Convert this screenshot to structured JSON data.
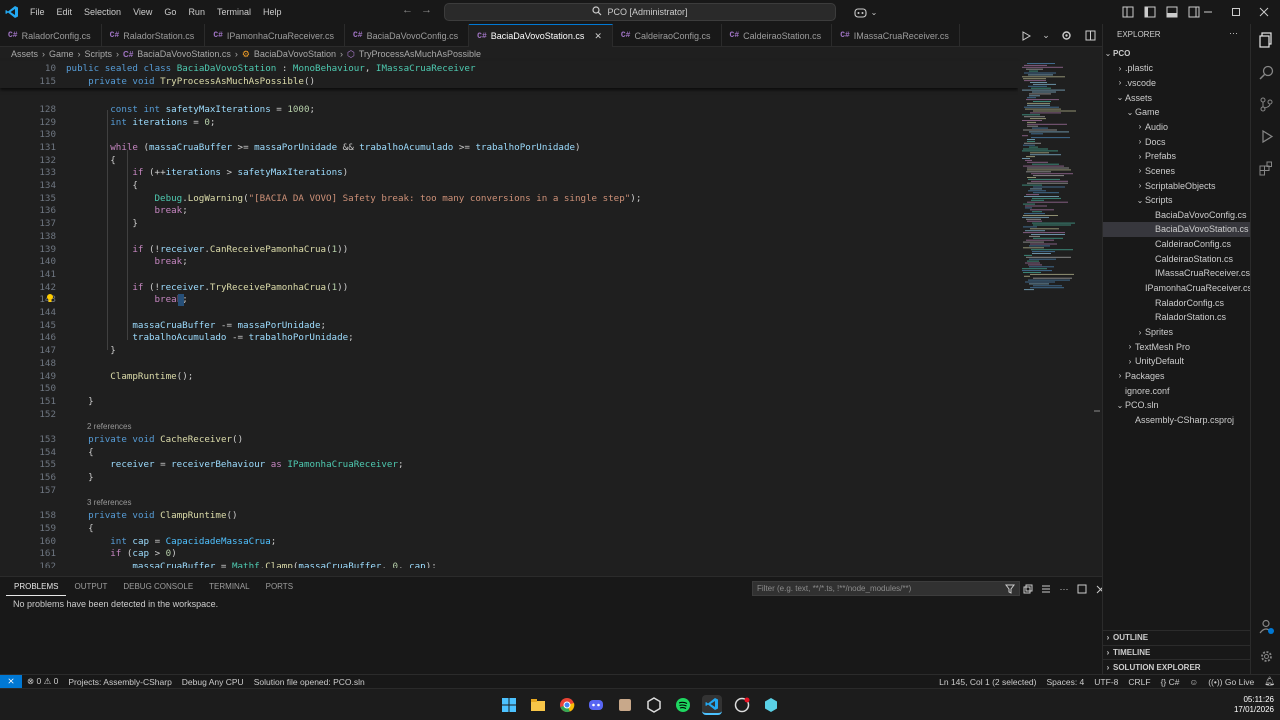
{
  "menu": [
    "File",
    "Edit",
    "Selection",
    "View",
    "Go",
    "Run",
    "Terminal",
    "Help"
  ],
  "command_center": "PCO [Administrator]",
  "tabs": [
    {
      "label": "RaladorConfig.cs",
      "active": false
    },
    {
      "label": "RaladorStation.cs",
      "active": false
    },
    {
      "label": "IPamonhaCruaReceiver.cs",
      "active": false
    },
    {
      "label": "BaciaDaVovoConfig.cs",
      "active": false
    },
    {
      "label": "BaciaDaVovoStation.cs",
      "active": true
    },
    {
      "label": "CaldeiraoConfig.cs",
      "active": false
    },
    {
      "label": "CaldeiraoStation.cs",
      "active": false
    },
    {
      "label": "IMassaCruaReceiver.cs",
      "active": false
    }
  ],
  "tab_icon_text": "C#",
  "breadcrumb": {
    "p1": "Assets",
    "p2": "Game",
    "p3": "Scripts",
    "p4": "BaciaDaVovoStation.cs",
    "p5": "BaciaDaVovoStation",
    "p6": "TryProcessAsMuchAsPossible"
  },
  "sticky": [
    {
      "num": "10",
      "code": "public sealed class BaciaDaVovoStation : MonoBehaviour, IMassaCruaReceiver"
    },
    {
      "num": "115",
      "code": "    private void TryProcessAsMuchAsPossible()"
    }
  ],
  "lines": [
    {
      "num": "128",
      "code": "        const int safetyMaxIterations = 1000;"
    },
    {
      "num": "129",
      "code": "        int iterations = 0;"
    },
    {
      "num": "130",
      "code": ""
    },
    {
      "num": "131",
      "code": "        while (massaCruaBuffer >= massaPorUnidade && trabalhoAcumulado >= trabalhoPorUnidade)"
    },
    {
      "num": "132",
      "code": "        {"
    },
    {
      "num": "133",
      "code": "            if (++iterations > safetyMaxIterations)"
    },
    {
      "num": "134",
      "code": "            {"
    },
    {
      "num": "135",
      "code": "                Debug.LogWarning(\"[BACIA DA VOVO] Safety break: too many conversions in a single step\");"
    },
    {
      "num": "136",
      "code": "                break;"
    },
    {
      "num": "137",
      "code": "            }"
    },
    {
      "num": "138",
      "code": ""
    },
    {
      "num": "139",
      "code": "            if (!receiver.CanReceivePamonhaCrua(1))"
    },
    {
      "num": "140",
      "code": "                break;"
    },
    {
      "num": "141",
      "code": ""
    },
    {
      "num": "142",
      "code": "            if (!receiver.TryReceivePamonhaCrua(1))"
    },
    {
      "num": "143",
      "code": "                break;"
    },
    {
      "num": "144",
      "code": ""
    },
    {
      "num": "145",
      "code": "            massaCruaBuffer -= massaPorUnidade;"
    },
    {
      "num": "146",
      "code": "            trabalhoAcumulado -= trabalhoPorUnidade;"
    },
    {
      "num": "147",
      "code": "        }"
    },
    {
      "num": "148",
      "code": ""
    },
    {
      "num": "149",
      "code": "        ClampRuntime();"
    },
    {
      "num": "150",
      "code": ""
    },
    {
      "num": "151",
      "code": "    }"
    },
    {
      "num": "152",
      "code": ""
    }
  ],
  "codelens_1": "2 references",
  "lines_b": [
    {
      "num": "153",
      "code": "    private void CacheReceiver()"
    },
    {
      "num": "154",
      "code": "    {"
    },
    {
      "num": "155",
      "code": "        receiver = receiverBehaviour as IPamonhaCruaReceiver;"
    },
    {
      "num": "156",
      "code": "    }"
    },
    {
      "num": "157",
      "code": ""
    }
  ],
  "codelens_2": "3 references",
  "lines_c": [
    {
      "num": "158",
      "code": "    private void ClampRuntime()"
    },
    {
      "num": "159",
      "code": "    {"
    },
    {
      "num": "160",
      "code": "        int cap = CapacidadeMassaCrua;"
    },
    {
      "num": "161",
      "code": "        if (cap > 0)"
    },
    {
      "num": "162",
      "code": "            massaCruaBuffer = Mathf.Clamp(massaCruaBuffer, 0, cap);"
    }
  ],
  "panel": {
    "tabs": [
      "Problems",
      "Output",
      "Debug Console",
      "Terminal",
      "Ports"
    ],
    "filter_placeholder": "Filter (e.g. text, **/*.ts, !**/node_modules/**)",
    "message": "No problems have been detected in the workspace."
  },
  "explorer": {
    "title": "EXPLORER",
    "root": "PCO",
    "items": [
      {
        "label": ".plastic",
        "depth": 1,
        "chev": "›",
        "sel": false
      },
      {
        "label": ".vscode",
        "depth": 1,
        "chev": "›",
        "sel": false
      },
      {
        "label": "Assets",
        "depth": 1,
        "chev": "⌄",
        "sel": false
      },
      {
        "label": "Game",
        "depth": 2,
        "chev": "⌄",
        "sel": false
      },
      {
        "label": "Audio",
        "depth": 3,
        "chev": "›",
        "sel": false
      },
      {
        "label": "Docs",
        "depth": 3,
        "chev": "›",
        "sel": false
      },
      {
        "label": "Prefabs",
        "depth": 3,
        "chev": "›",
        "sel": false
      },
      {
        "label": "Scenes",
        "depth": 3,
        "chev": "›",
        "sel": false
      },
      {
        "label": "ScriptableObjects",
        "depth": 3,
        "chev": "›",
        "sel": false
      },
      {
        "label": "Scripts",
        "depth": 3,
        "chev": "⌄",
        "sel": false
      },
      {
        "label": "BaciaDaVovoConfig.cs",
        "depth": 4,
        "chev": "",
        "sel": false
      },
      {
        "label": "BaciaDaVovoStation.cs",
        "depth": 4,
        "chev": "",
        "sel": true
      },
      {
        "label": "CaldeiraoConfig.cs",
        "depth": 4,
        "chev": "",
        "sel": false
      },
      {
        "label": "CaldeiraoStation.cs",
        "depth": 4,
        "chev": "",
        "sel": false
      },
      {
        "label": "IMassaCruaReceiver.cs",
        "depth": 4,
        "chev": "",
        "sel": false
      },
      {
        "label": "IPamonhaCruaReceiver.cs",
        "depth": 4,
        "chev": "",
        "sel": false
      },
      {
        "label": "RaladorConfig.cs",
        "depth": 4,
        "chev": "",
        "sel": false
      },
      {
        "label": "RaladorStation.cs",
        "depth": 4,
        "chev": "",
        "sel": false
      },
      {
        "label": "Sprites",
        "depth": 3,
        "chev": "›",
        "sel": false
      },
      {
        "label": "TextMesh Pro",
        "depth": 2,
        "chev": "›",
        "sel": false
      },
      {
        "label": "UnityDefault",
        "depth": 2,
        "chev": "›",
        "sel": false
      },
      {
        "label": "Packages",
        "depth": 1,
        "chev": "›",
        "sel": false
      },
      {
        "label": "ignore.conf",
        "depth": 1,
        "chev": "",
        "sel": false
      },
      {
        "label": "PCO.sln",
        "depth": 1,
        "chev": "⌄",
        "sel": false
      },
      {
        "label": "Assembly-CSharp.csproj",
        "depth": 2,
        "chev": "",
        "sel": false
      }
    ],
    "sections": [
      "OUTLINE",
      "TIMELINE",
      "SOLUTION EXPLORER"
    ]
  },
  "status": {
    "errors": "0",
    "warnings": "0",
    "projects": "Projects: Assembly-CSharp",
    "debug": "Debug Any CPU",
    "solution": "Solution file opened: PCO.sln",
    "position": "Ln 145, Col 1 (2 selected)",
    "spaces": "Spaces: 4",
    "encoding": "UTF-8",
    "eol": "CRLF",
    "language": "C#",
    "golive": "Go Live"
  },
  "clock": {
    "time": "05:11:26",
    "date": "17/01/2026"
  },
  "colors": {
    "accent": "#0078d4",
    "bg": "#1f1f1f",
    "bar": "#181818"
  }
}
